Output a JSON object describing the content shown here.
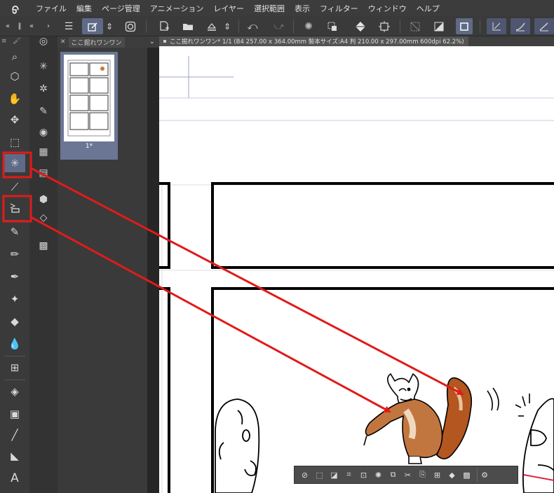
{
  "menubar": {
    "items": [
      "ファイル",
      "編集",
      "ページ管理",
      "アニメーション",
      "レイヤー",
      "選択範囲",
      "表示",
      "フィルター",
      "ウィンドウ",
      "ヘルプ"
    ]
  },
  "toolbar": {
    "icons": [
      "collapse-left-icon",
      "hamburger-menu-icon",
      "edit-layer-icon",
      "up-down-icon",
      "spiral-icon",
      "new-file-icon",
      "open-folder-icon",
      "save-cloud-icon",
      "updown-small-icon",
      "undo-icon",
      "redo-icon",
      "loading-icon",
      "select-icon",
      "fill-icon",
      "transform-icon",
      "clear-select-icon",
      "contrast-icon",
      "frame-icon",
      "ruler-check-icon",
      "pen-stroke-icon",
      "ruler-icon"
    ]
  },
  "page_panel": {
    "tab_label": "ここ掘れワンワン",
    "page_label": "1*"
  },
  "canvas": {
    "tab_title": "ここ掘れワンワン* 1/1 (B4 257.00 x 364.00mm 製本サイズ:A4 判 210.00 x 297.00mm 600dpi 62.2%)"
  },
  "colors": {
    "accent": "#5f6a86",
    "highlight": "#e01b1b",
    "fox_fur": "#b4561f"
  }
}
